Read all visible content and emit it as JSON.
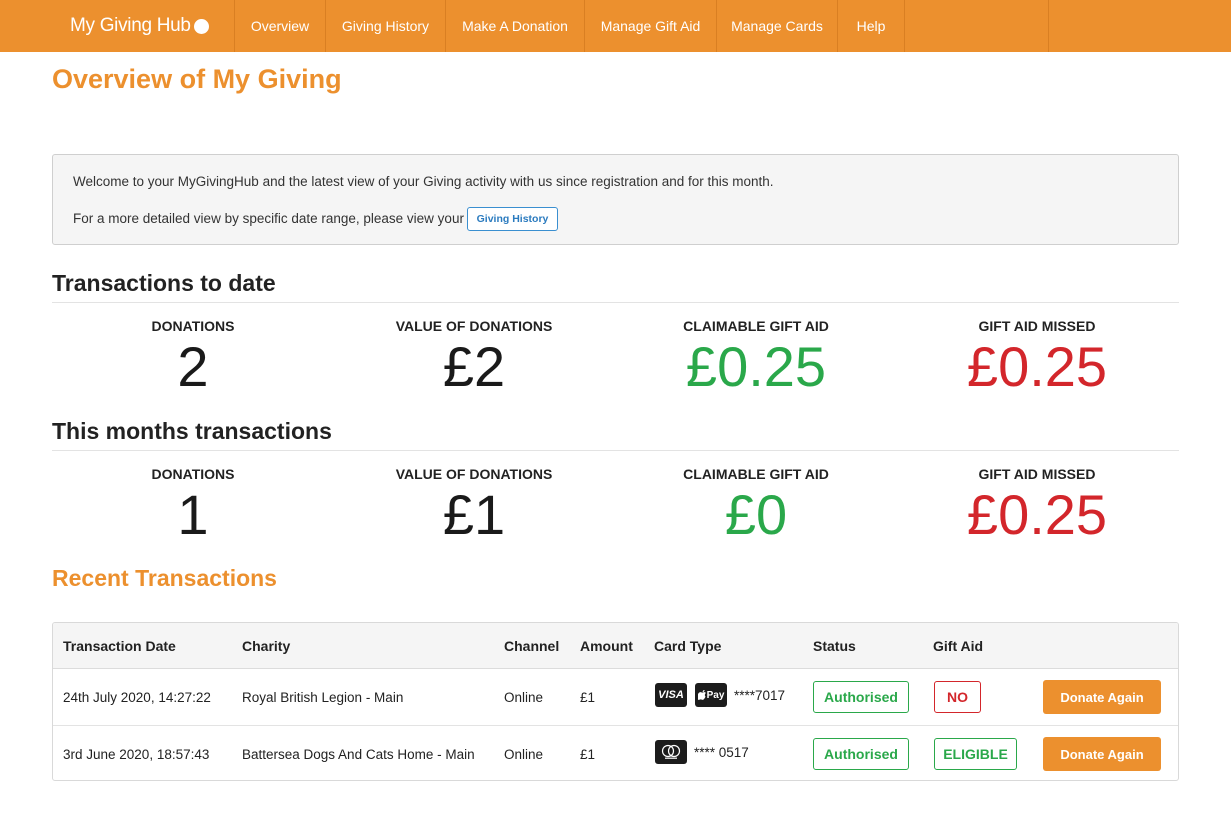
{
  "nav": {
    "brand": "My Giving Hub",
    "items": [
      "Overview",
      "Giving History",
      "Make A Donation",
      "Manage Gift Aid",
      "Manage Cards",
      "Help"
    ]
  },
  "page_title": "Overview of My Giving",
  "welcome": {
    "line1": "Welcome to your MyGivingHub and the latest view of your Giving activity with us since registration and for this month.",
    "line2": "For a more detailed view by specific date range, please view your",
    "button": "Giving History"
  },
  "to_date": {
    "heading": "Transactions to date",
    "stats": [
      {
        "label": "DONATIONS",
        "value": "2"
      },
      {
        "label": "VALUE OF DONATIONS",
        "value": "£2"
      },
      {
        "label": "CLAIMABLE GIFT AID",
        "value": "£0.25"
      },
      {
        "label": "GIFT AID MISSED",
        "value": "£0.25"
      }
    ]
  },
  "this_month": {
    "heading": "This months transactions",
    "stats": [
      {
        "label": "DONATIONS",
        "value": "1"
      },
      {
        "label": "VALUE OF DONATIONS",
        "value": "£1"
      },
      {
        "label": "CLAIMABLE GIFT AID",
        "value": "£0"
      },
      {
        "label": "GIFT AID MISSED",
        "value": "£0.25"
      }
    ]
  },
  "recent": {
    "heading": "Recent Transactions",
    "columns": [
      "Transaction Date",
      "Charity",
      "Channel",
      "Amount",
      "Card Type",
      "Status",
      "Gift Aid"
    ],
    "rows": [
      {
        "date": "24th July 2020, 14:27:22",
        "charity": "Royal British Legion - Main",
        "channel": "Online",
        "amount": "£1",
        "card_icons": [
          "VISA",
          "Pay"
        ],
        "card_number": "****7017",
        "status": "Authorised",
        "gift_aid": "NO",
        "action": "Donate Again"
      },
      {
        "date": "3rd June 2020, 18:57:43",
        "charity": "Battersea Dogs And Cats Home - Main",
        "channel": "Online",
        "amount": "£1",
        "card_icons": [
          "mastercard"
        ],
        "card_number": "**** 0517",
        "status": "Authorised",
        "gift_aid": "ELIGIBLE",
        "action": "Donate Again"
      }
    ]
  },
  "colors": {
    "brand_orange": "#ec902e",
    "positive_green": "#2aa84a",
    "negative_red": "#d3262b",
    "link_blue": "#2b7bbf"
  }
}
